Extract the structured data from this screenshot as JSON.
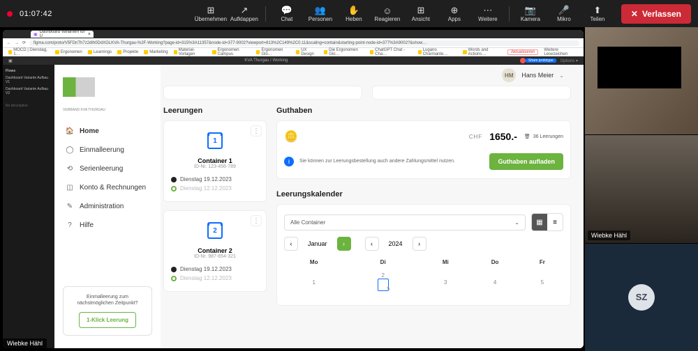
{
  "meeting": {
    "timer": "01:07:42",
    "tools": {
      "takeover": "Übernehmen",
      "expand": "Aufklappen",
      "chat": "Chat",
      "people": "Personen",
      "raise": "Heben",
      "react": "Reagieren",
      "view": "Ansicht",
      "apps": "Apps",
      "more": "Weitere",
      "camera": "Kamera",
      "mic": "Mikro",
      "share": "Teilen"
    },
    "leave": "Verlassen",
    "presenter": "Wiebke Hähl",
    "cams": {
      "p2": "Wiebke Hähl",
      "p3_initials": "SZ"
    }
  },
  "browser": {
    "tab_title": "Dashboard Varianten für U",
    "url": "figma.com/proto/V5FDnTh7z2dlh0DdXGLKVA-Thurgau-%2F-Working?page-id=315%3A11357&node-id=377-9002?viewport=813%2C149%2C0.11&scaling=contain&starting-point-node-id=377%3A9002?&show…",
    "bookmarks": [
      "MOCD | Dienstag, 1…",
      "Ergonomen",
      "Learnings",
      "Projekte",
      "Marketing",
      "Material-Vorlagen",
      "Ergonomen Campus",
      "Ergonomen Glo…",
      "UX Design",
      "Die Ergonomen Glo…",
      "ChatGPT Chat - Cha…",
      "Lugano Charmante…",
      "Words and Actions…",
      "Aktualisieren",
      "Weitere Lesezeichen"
    ]
  },
  "figma": {
    "title": "KVA Thurgau / Working",
    "share": "Share prototype",
    "options": "Options",
    "flows": "Flows",
    "v1": "Dashboard Variante Aufbau V1",
    "v2": "Dashboard Variante Aufbau V2",
    "no_desc": "No description"
  },
  "app": {
    "brand_sub": "VERBAND KVA THURGAU",
    "nav": {
      "home": "Home",
      "single": "Einmalleerung",
      "series": "Serienleerung",
      "account": "Konto & Rechnungen",
      "admin": "Administration",
      "help": "Hilfe"
    },
    "promo": {
      "line": "Einmalleerung zum nächstmöglichen Zeitpunkt?",
      "cta": "1-Klick Leerung"
    },
    "user": {
      "initials": "HM",
      "name": "Hans Meier"
    },
    "leerungen": {
      "title": "Leerungen",
      "c1": {
        "name": "Container 1",
        "id": "ID-Nr. 123-456-789",
        "d1": "Dienstag 19.12.2023",
        "d2": "Dienstag 12.12.2023"
      },
      "c2": {
        "name": "Container 2",
        "id": "ID-Nr. 987-654-321",
        "d1": "Dienstag 19.12.2023",
        "d2": "Dienstag 12.12.2023"
      }
    },
    "guthaben": {
      "title": "Guthaben",
      "chf": "CHF",
      "amount": "1650.-",
      "leerungen": "36 Leerungen",
      "info": "Sie können zur Leerungsbestellung auch andere Zahlungsmittel nutzen.",
      "topup": "Guthaben aufladen"
    },
    "calendar": {
      "title": "Leerungskalender",
      "filter": "Alle Container",
      "month": "Januar",
      "year": "2024",
      "days": {
        "mo": "Mo",
        "di": "Di",
        "mi": "Mi",
        "do": "Do",
        "fr": "Fr"
      },
      "w1": [
        "1",
        "2",
        "3",
        "4",
        "5"
      ]
    }
  }
}
